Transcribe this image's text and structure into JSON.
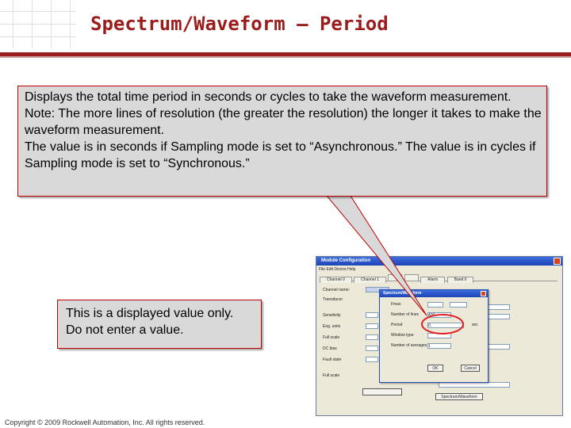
{
  "slide": {
    "title": "Spectrum/Waveform – Period",
    "accent_color": "#9b1c1c",
    "callout_main": {
      "line1": "Displays the total time period in seconds or cycles to take the waveform measurement.",
      "line2": "Note: The more lines of resolution (the greater the resolution) the longer it takes to make the waveform measurement.",
      "line3": "The value is in seconds if Sampling mode is set to “Asynchronous.” The value is in cycles if Sampling mode is set to “Synchronous.”"
    },
    "callout_small": {
      "line1": "This is a displayed value only.",
      "line2": "Do not enter a value."
    },
    "footer": "Copyright © 2009 Rockwell Automation, Inc. All rights reserved."
  },
  "dialog": {
    "title": "Module Configuration",
    "menu": "File  Edit  Device  Help",
    "tabs": [
      "Channel 0",
      "Channel 1",
      "",
      "",
      "Alarm",
      "Band 0"
    ],
    "rows": [
      "Channel name:",
      "Transducer",
      "Sensitivity",
      "Eng. units",
      "Full scale",
      "DC bias",
      "Fault state",
      "Full scale"
    ],
    "button": "Spectrum/Waveform"
  },
  "subdialog": {
    "title": "Spectrum/Waveform",
    "fields": [
      {
        "label": "Fmax",
        "value": ""
      },
      {
        "label": "Number of lines",
        "value": "400"
      },
      {
        "label": "Period",
        "value": "0."
      },
      {
        "label": "Window type",
        "value": ""
      },
      {
        "label": "Number of averages",
        "value": "1"
      }
    ],
    "unit": "sec",
    "ok": "OK",
    "cancel": "Cancel"
  }
}
